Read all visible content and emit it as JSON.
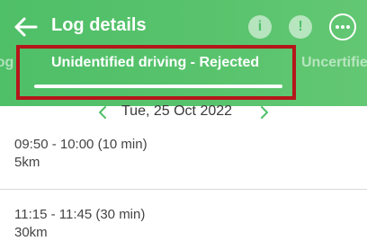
{
  "header": {
    "title": "Log details",
    "info_icon_glyph": "i",
    "alert_icon_glyph": "!",
    "accent_color": "#4fbf68"
  },
  "tabs": {
    "previous_partial": "Log",
    "active": "Unidentified driving - Rejected",
    "next_partial": "Uncertified"
  },
  "date": {
    "label": "Tue, 25 Oct 2022"
  },
  "entries": [
    {
      "time": "09:50 - 10:00 (10 min)",
      "distance": "5km"
    },
    {
      "time": "11:15 - 11:45 (30 min)",
      "distance": "30km"
    }
  ],
  "annotation": {
    "highlight_color": "#b5161a"
  }
}
